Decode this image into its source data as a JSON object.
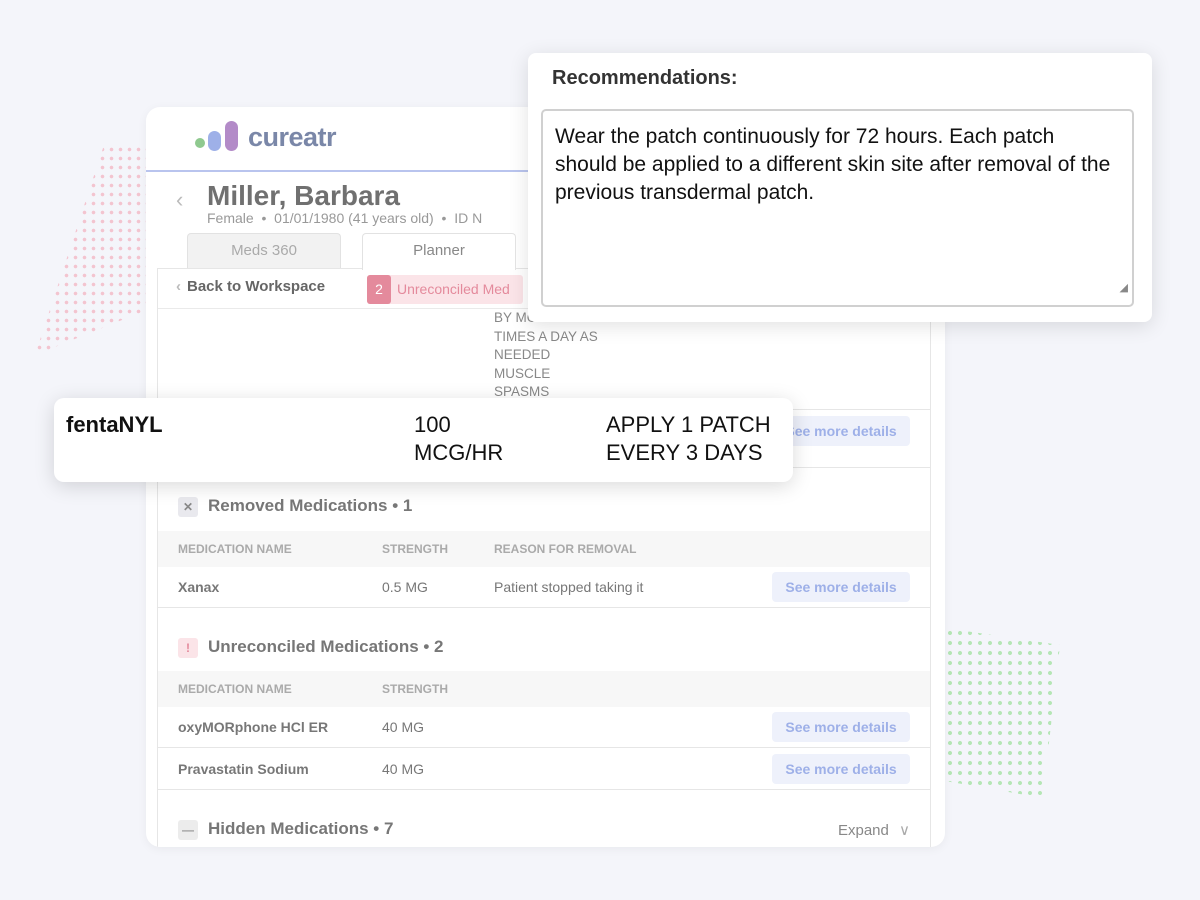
{
  "app": {
    "logo_text": "cureatr"
  },
  "patient": {
    "name": "Miller, Barbara",
    "sex": "Female",
    "dob": "01/01/1980 (41 years old)",
    "id_label": "ID N"
  },
  "tabs": [
    {
      "label": "Meds 360",
      "active": false
    },
    {
      "label": "Planner",
      "active": true
    }
  ],
  "toolbar": {
    "back_label": "Back to Workspace",
    "unreconciled_count": "2",
    "unreconciled_label": "Unreconciled Med"
  },
  "sig_lines": [
    "BY MO",
    "TIMES A DAY AS",
    "NEEDED",
    "MUSCLE",
    "SPASMS"
  ],
  "highlight": {
    "name": "fentaNYL",
    "strength_line1": "100",
    "strength_line2": "MCG/HR",
    "sig_line1": "APPLY 1 PATCH",
    "sig_line2": "EVERY 3 DAYS",
    "see_more": "See more details"
  },
  "removed": {
    "icon": "x-icon",
    "title": "Removed Medications • 1",
    "headers": [
      "MEDICATION NAME",
      "STRENGTH",
      "REASON FOR REMOVAL"
    ],
    "rows": [
      {
        "name": "Xanax",
        "strength": "0.5 MG",
        "reason": "Patient stopped taking it",
        "action": "See more details"
      }
    ]
  },
  "unreconciled": {
    "icon": "exclamation-icon",
    "title": "Unreconciled Medications • 2",
    "headers": [
      "MEDICATION NAME",
      "STRENGTH"
    ],
    "rows": [
      {
        "name": "oxyMORphone HCl ER",
        "strength": "40 MG",
        "action": "See more details"
      },
      {
        "name": "Pravastatin Sodium",
        "strength": "40 MG",
        "action": "See more details"
      }
    ]
  },
  "hidden": {
    "icon": "minus-icon",
    "title": "Hidden Medications • 7",
    "expand_label": "Expand"
  },
  "recommendations": {
    "title": "Recommendations:",
    "text": "Wear the patch continuously for 72 hours. Each patch should be applied to a different skin site after removal of the previous transdermal patch."
  },
  "colors": {
    "accent_blue": "#9eb0e8",
    "alert_pink": "#e48a9c",
    "logo_purple": "#b38bc8",
    "logo_green": "#8fc98f"
  }
}
